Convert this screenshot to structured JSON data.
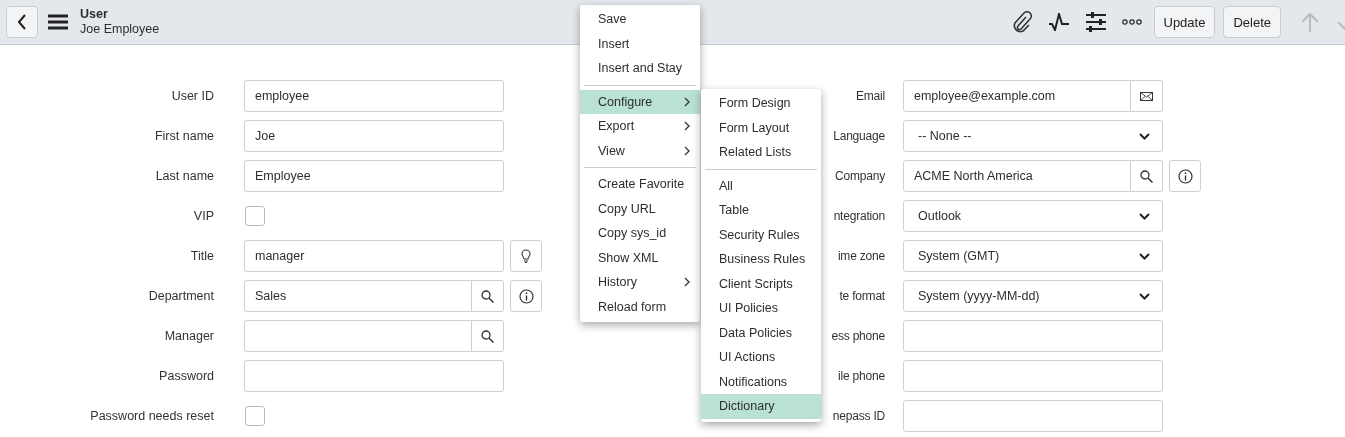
{
  "header": {
    "title": "User",
    "subtitle": "Joe Employee",
    "buttons": [
      "Update",
      "Delete"
    ],
    "nav": [
      {
        "kind": "up",
        "disabled": true
      },
      {
        "kind": "down",
        "disabled": true
      }
    ]
  },
  "form": {
    "left": [
      {
        "label": "User ID",
        "kind": "text",
        "value": "employee"
      },
      {
        "label": "First name",
        "kind": "text",
        "value": "Joe"
      },
      {
        "label": "Last name",
        "kind": "text",
        "value": "Employee"
      },
      {
        "label": "VIP",
        "kind": "checkbox",
        "checked": false
      },
      {
        "label": "Title",
        "kind": "text",
        "value": "manager",
        "addon": {
          "kind": "hint"
        }
      },
      {
        "label": "Department",
        "kind": "reference",
        "value": "Sales",
        "addon": {
          "kind": "info"
        }
      },
      {
        "label": "Manager",
        "kind": "reference"
      },
      {
        "label": "Password",
        "kind": "text"
      },
      {
        "label": "Password needs reset",
        "kind": "checkbox",
        "checked": false
      }
    ],
    "right": [
      {
        "label": "Email",
        "kind": "email",
        "value": "employee@example.com"
      },
      {
        "label": "Language",
        "kind": "select",
        "value": "-- None --"
      },
      {
        "label": "Company",
        "kind": "reference",
        "value": "ACME North America",
        "addon": {
          "kind": "info"
        }
      },
      {
        "label": "ntegration",
        "kind": "select",
        "value": "Outlook"
      },
      {
        "label": "ime zone",
        "kind": "select",
        "value": "System (GMT)"
      },
      {
        "label": "te format",
        "kind": "select",
        "value": "System (yyyy-MM-dd)"
      },
      {
        "label": "ess phone",
        "kind": "text"
      },
      {
        "label": "ile phone",
        "kind": "text"
      },
      {
        "label": "nepass ID",
        "kind": "text"
      }
    ]
  },
  "context_menu": {
    "groups": [
      [
        {
          "label": "Save",
          "submenu": false,
          "selected": false
        },
        {
          "label": "Insert",
          "submenu": false,
          "selected": false
        },
        {
          "label": "Insert and Stay",
          "submenu": false,
          "selected": false
        }
      ],
      [
        {
          "label": "Configure",
          "submenu": true,
          "selected": true
        },
        {
          "label": "Export",
          "submenu": true,
          "selected": false
        },
        {
          "label": "View",
          "submenu": true,
          "selected": false
        }
      ],
      [
        {
          "label": "Create Favorite",
          "submenu": false,
          "selected": false
        },
        {
          "label": "Copy URL",
          "submenu": false,
          "selected": false
        },
        {
          "label": "Copy sys_id",
          "submenu": false,
          "selected": false
        },
        {
          "label": "Show XML",
          "submenu": false,
          "selected": false
        },
        {
          "label": "History",
          "submenu": true,
          "selected": false
        },
        {
          "label": "Reload form",
          "submenu": false,
          "selected": false
        }
      ]
    ]
  },
  "submenu": {
    "groups": [
      [
        {
          "label": "Form Design",
          "submenu": false,
          "selected": false
        },
        {
          "label": "Form Layout",
          "submenu": false,
          "selected": false
        },
        {
          "label": "Related Lists",
          "submenu": false,
          "selected": false
        }
      ],
      [
        {
          "label": "All",
          "submenu": false,
          "selected": false
        },
        {
          "label": "Table",
          "submenu": false,
          "selected": false
        },
        {
          "label": "Security Rules",
          "submenu": false,
          "selected": false
        },
        {
          "label": "Business Rules",
          "submenu": false,
          "selected": false
        },
        {
          "label": "Client Scripts",
          "submenu": false,
          "selected": false
        },
        {
          "label": "UI Policies",
          "submenu": false,
          "selected": false
        },
        {
          "label": "Data Policies",
          "submenu": false,
          "selected": false
        },
        {
          "label": "UI Actions",
          "submenu": false,
          "selected": false
        },
        {
          "label": "Notifications",
          "submenu": false,
          "selected": false
        },
        {
          "label": "Dictionary",
          "submenu": false,
          "selected": true
        }
      ]
    ]
  }
}
